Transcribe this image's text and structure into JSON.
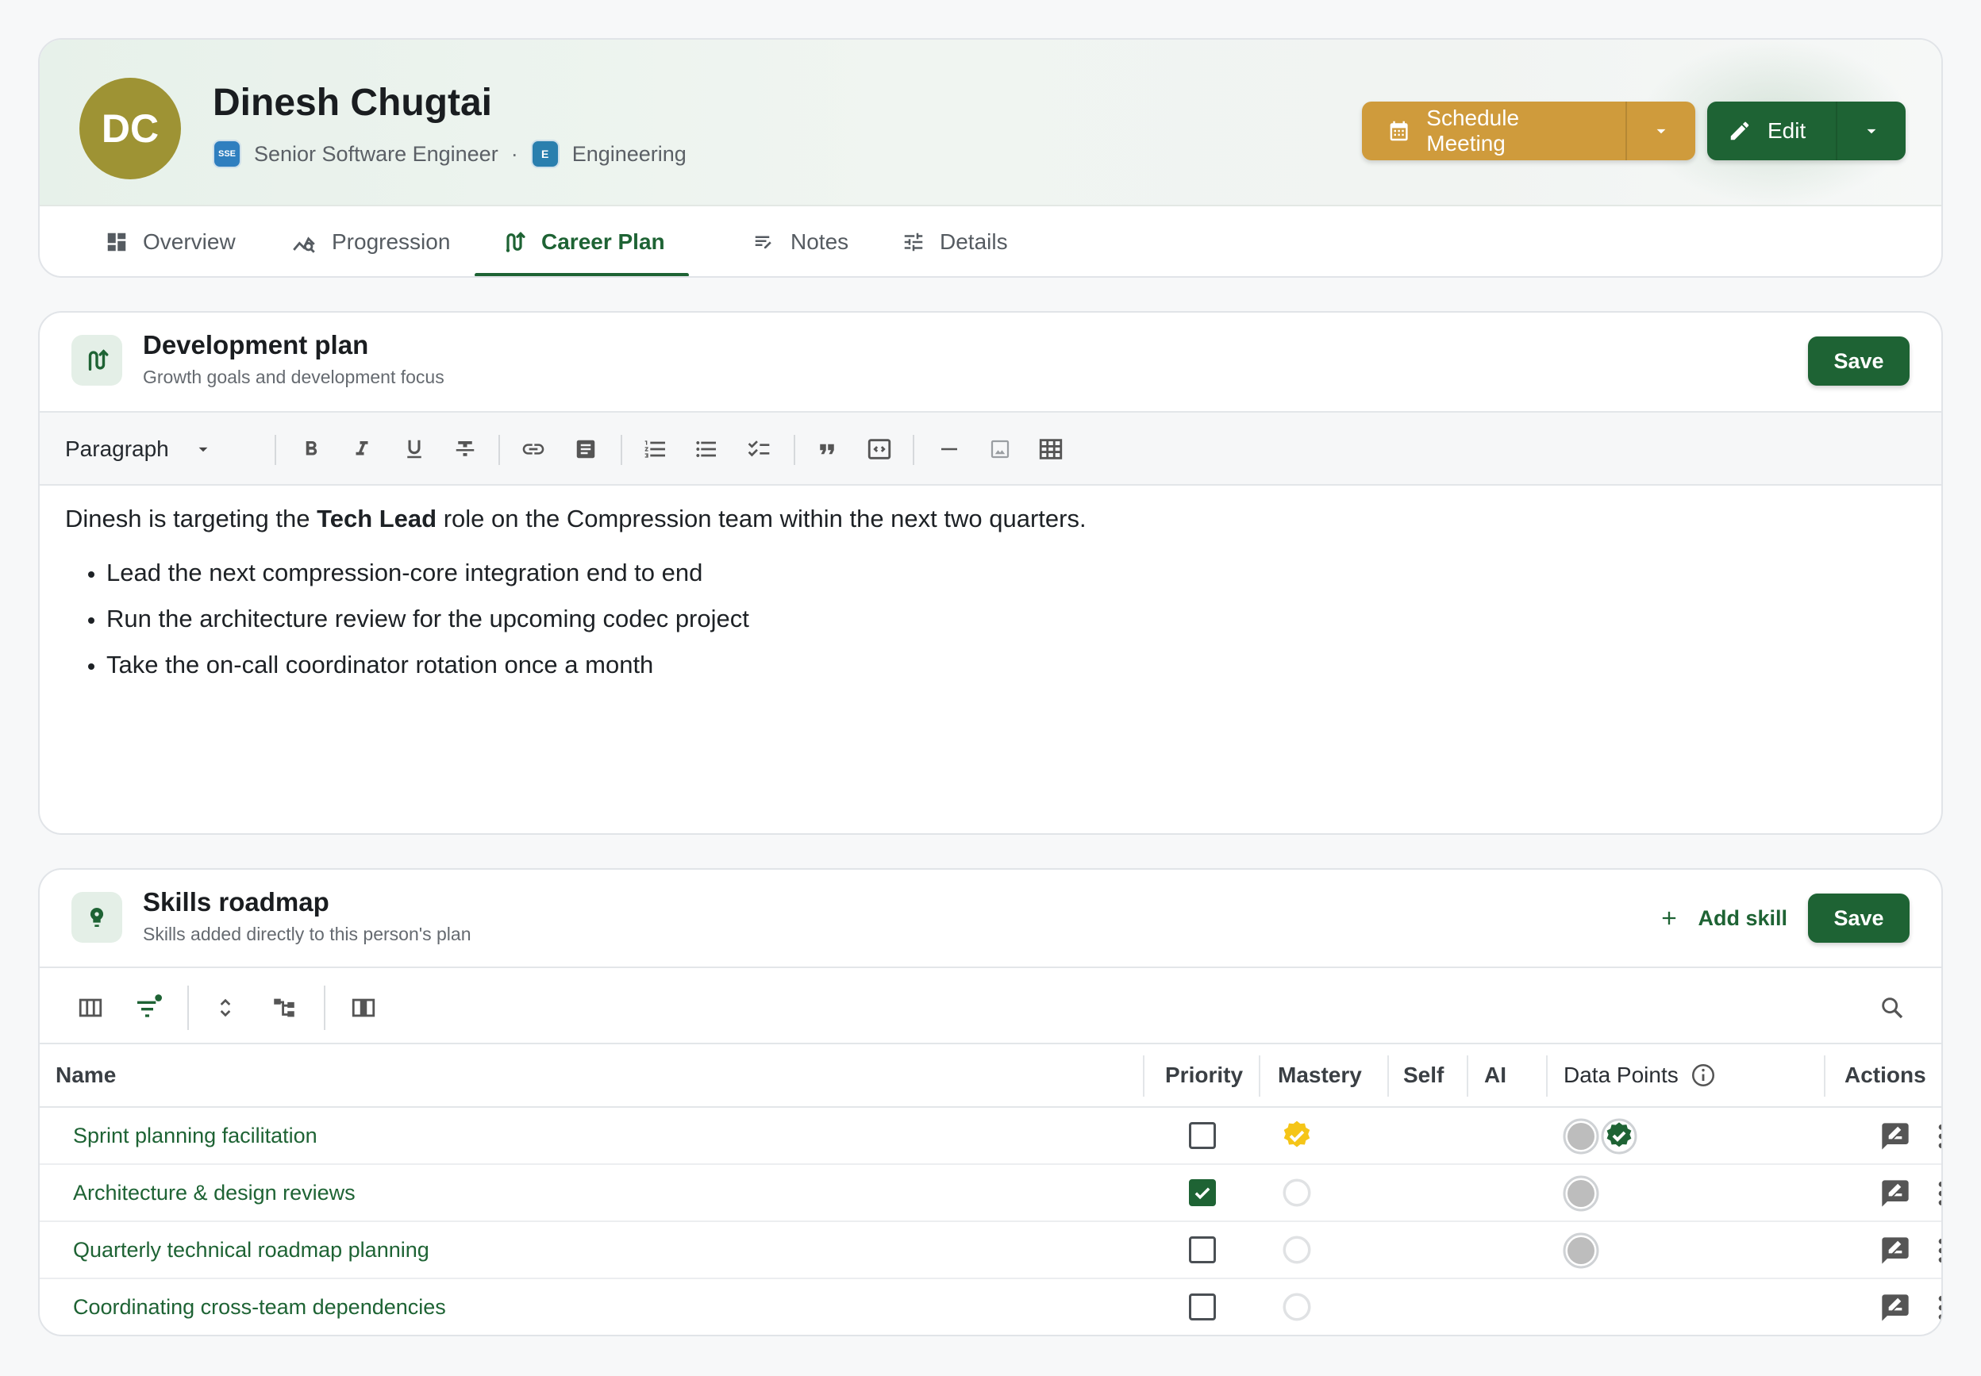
{
  "profile": {
    "initials": "DC",
    "name": "Dinesh Chugtai",
    "role_badge": "SSE",
    "role": "Senior Software Engineer",
    "separator": "·",
    "dept_badge": "E",
    "department": "Engineering",
    "avatar_color": "#9e9334"
  },
  "actions": {
    "schedule_label": "Schedule Meeting",
    "edit_label": "Edit",
    "schedule_color": "#cf9b3c",
    "edit_color": "#1e6334"
  },
  "tabs": [
    {
      "label": "Overview",
      "icon": "dashboard-icon",
      "active": false
    },
    {
      "label": "Progression",
      "icon": "progression-icon",
      "active": false
    },
    {
      "label": "Career Plan",
      "icon": "career-plan-icon",
      "active": true
    },
    {
      "label": "Notes",
      "icon": "notes-icon",
      "active": false
    },
    {
      "label": "Details",
      "icon": "tune-icon",
      "active": false
    }
  ],
  "dev_plan": {
    "title": "Development plan",
    "subtitle": "Growth goals and development focus",
    "save_label": "Save",
    "toolbar": {
      "block_style": "Paragraph",
      "buttons": [
        "bold-icon",
        "italic-icon",
        "underline-icon",
        "strikethrough-icon",
        "link-icon",
        "text-box-icon",
        "ordered-list-icon",
        "bullet-list-icon",
        "checklist-icon",
        "quote-icon",
        "code-block-icon",
        "horizontal-rule-icon",
        "image-icon",
        "table-icon"
      ]
    },
    "content": {
      "intro_before": "Dinesh is targeting the ",
      "intro_bold": "Tech Lead",
      "intro_after": " role on the Compression team within the next two quarters.",
      "bullets": [
        "Lead the next compression-core integration end to end",
        "Run the architecture review for the upcoming codec project",
        "Take the on-call coordinator rotation once a month"
      ]
    }
  },
  "skills": {
    "title": "Skills roadmap",
    "subtitle": "Skills added directly to this person's plan",
    "add_label": "Add skill",
    "save_label": "Save",
    "columns": {
      "name": "Name",
      "priority": "Priority",
      "mastery": "Mastery",
      "self": "Self",
      "ai": "AI",
      "data_points": "Data Points",
      "actions": "Actions"
    },
    "rows": [
      {
        "name": "Sprint planning facilitation",
        "priority": false,
        "mastery": "verified",
        "data_points": [
          "empty",
          "verified"
        ]
      },
      {
        "name": "Architecture & design reviews",
        "priority": true,
        "mastery": "none",
        "data_points": [
          "empty"
        ]
      },
      {
        "name": "Quarterly technical roadmap planning",
        "priority": false,
        "mastery": "none",
        "data_points": [
          "empty"
        ]
      },
      {
        "name": "Coordinating cross-team dependencies",
        "priority": false,
        "mastery": "none",
        "data_points": []
      }
    ]
  }
}
